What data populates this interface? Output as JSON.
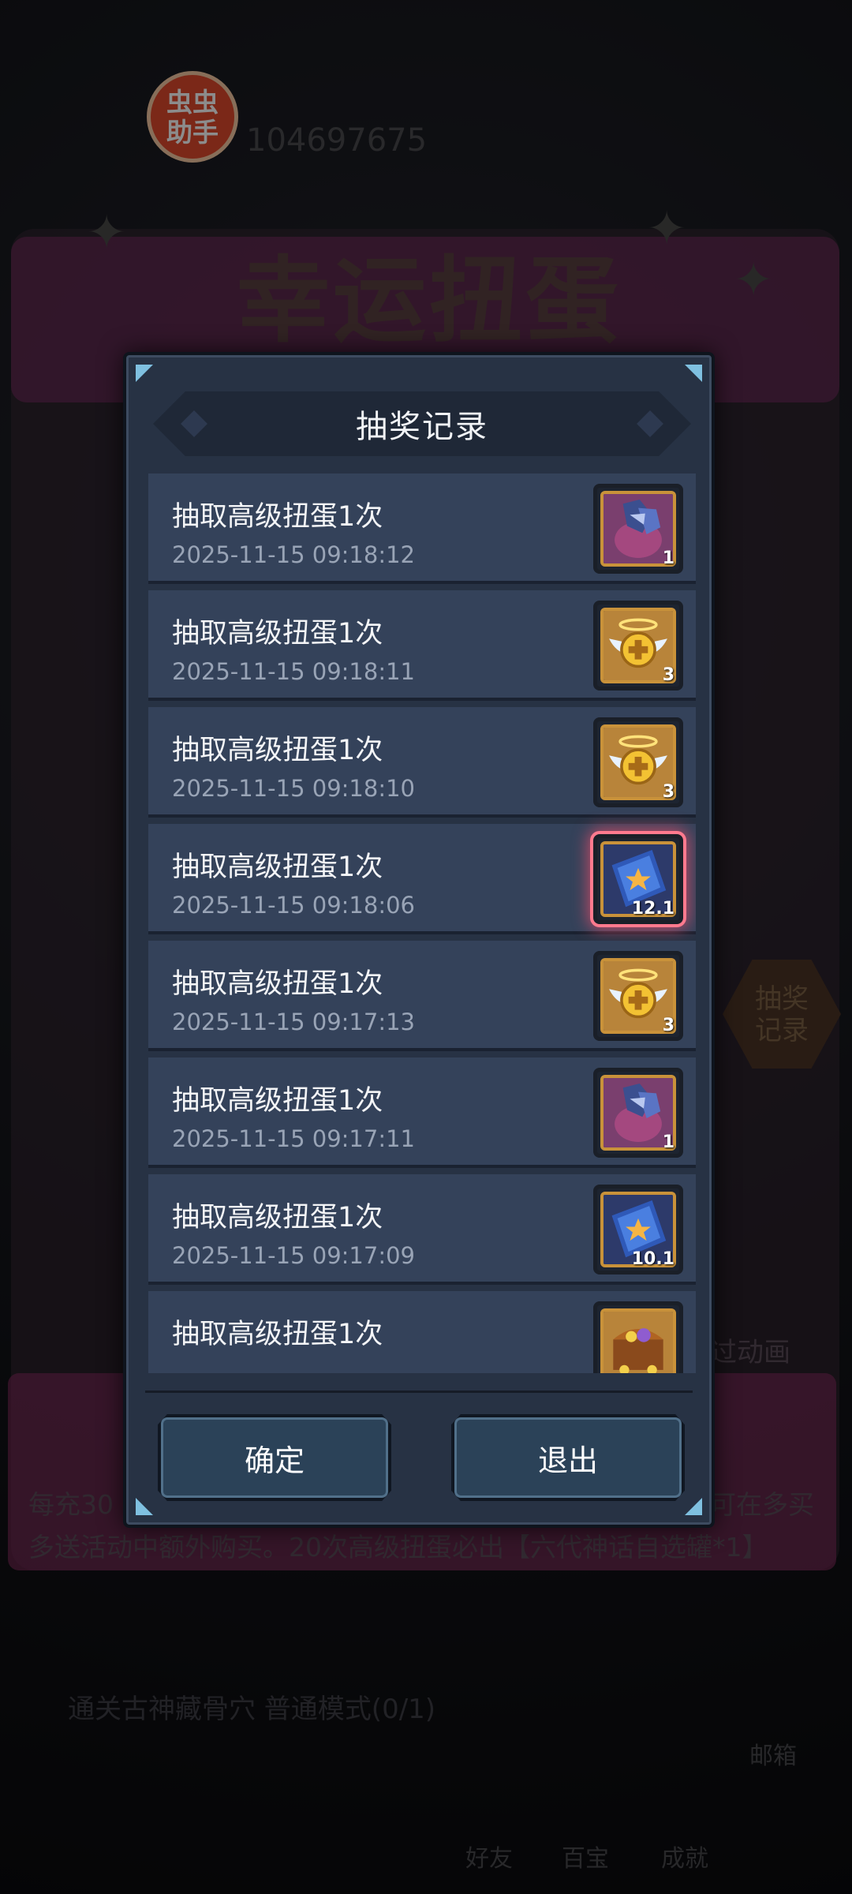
{
  "background": {
    "badge_text": "虫虫\n助手",
    "user_id": "104697675",
    "event_title": "幸运扭蛋",
    "side_button_label": "抽奖\n记录",
    "skip_animation_label": "过动画",
    "footer_line1": "每充30",
    "footer_line1_right": "可在多买",
    "footer_line2": "多送活动中额外购买。20次高级扭蛋必出【六代神话自选罐*1】",
    "quest_text": "通关古神藏骨穴 普通模式(0/1)",
    "mail_label": "邮箱",
    "nav_items": [
      "好友",
      "百宝",
      "成就"
    ]
  },
  "dialog": {
    "title": "抽奖记录",
    "records": [
      {
        "label": "抽取高级扭蛋1次",
        "time": "2025-11-15 09:18:12",
        "item_icon": "purple-gem-bag-icon",
        "count": "1"
      },
      {
        "label": "抽取高级扭蛋1次",
        "time": "2025-11-15 09:18:11",
        "item_icon": "gold-winged-coin-icon",
        "count": "3"
      },
      {
        "label": "抽取高级扭蛋1次",
        "time": "2025-11-15 09:18:10",
        "item_icon": "gold-winged-coin-icon",
        "count": "3"
      },
      {
        "label": "抽取高级扭蛋1次",
        "time": "2025-11-15 09:18:06",
        "item_icon": "blue-star-ticket-icon",
        "count": "12.1"
      },
      {
        "label": "抽取高级扭蛋1次",
        "time": "2025-11-15 09:17:13",
        "item_icon": "gold-winged-coin-icon",
        "count": "3"
      },
      {
        "label": "抽取高级扭蛋1次",
        "time": "2025-11-15 09:17:11",
        "item_icon": "purple-gem-bag-icon",
        "count": "1"
      },
      {
        "label": "抽取高级扭蛋1次",
        "time": "2025-11-15 09:17:09",
        "item_icon": "blue-star-ticket-icon",
        "count": "10.1"
      },
      {
        "label": "抽取高级扭蛋1次",
        "time": "",
        "item_icon": "treasure-chest-icon",
        "count": ""
      }
    ],
    "confirm_label": "确定",
    "exit_label": "退出"
  }
}
